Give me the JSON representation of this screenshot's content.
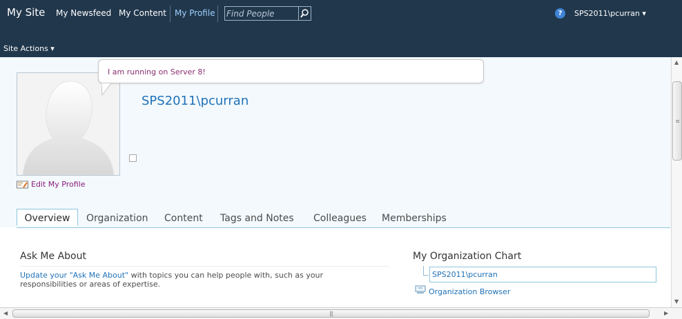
{
  "topbar": {
    "brand": "My Site",
    "nav": [
      {
        "label": "My Newsfeed"
      },
      {
        "label": "My Content"
      },
      {
        "label": "My Profile"
      }
    ],
    "search_placeholder": "Find People",
    "help_symbol": "?",
    "user": "SPS2011\\pcurran",
    "site_actions": "Site Actions"
  },
  "bubble": {
    "status": "I am running on Server 8!"
  },
  "profile": {
    "name": "SPS2011\\pcurran",
    "edit_link": "Edit My Profile"
  },
  "tabs": [
    {
      "label": "Overview",
      "active": true
    },
    {
      "label": "Organization"
    },
    {
      "label": "Content"
    },
    {
      "label": "Tags and Notes"
    },
    {
      "label": "Colleagues"
    },
    {
      "label": "Memberships"
    }
  ],
  "ask": {
    "title": "Ask Me About",
    "link_text": "Update your \"Ask Me About\"",
    "desc_rest": " with topics you can help people with, such as your responsibilities or areas of expertise."
  },
  "org": {
    "title": "My Organization Chart",
    "item": "SPS2011\\pcurran",
    "browser_link": "Organization Browser"
  },
  "icons": {
    "search": "search-icon",
    "help": "help-icon",
    "dropdown": "chevron-down-icon",
    "profile_photo": "person-silhouette-icon",
    "edit_profile": "edit-profile-icon",
    "organization_browser": "organization-browser-icon"
  },
  "colors": {
    "topbar": "#21374c",
    "link": "#2072b8",
    "status_text": "#892e6f",
    "tab_border": "#8ec6dc"
  }
}
